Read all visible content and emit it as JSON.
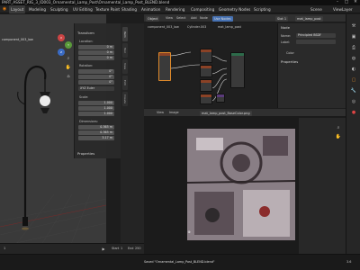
{
  "window": {
    "title": "PART_ASSET_RIG_3_ID003_Ornamental_Lamp_Post\\Ornamental_Lamp_Post_BLEND.blend",
    "minimize_icon": "minimize-icon",
    "maximize_icon": "maximize-icon",
    "close_icon": "close-icon"
  },
  "menubar": {
    "items": [
      "Layout",
      "Modeling",
      "Sculpting",
      "UV Editing",
      "Texture Paint",
      "Shading",
      "Animation",
      "Rendering",
      "Compositing",
      "Geometry Nodes",
      "Scripting"
    ],
    "active_index": 0,
    "scene_label": "Scene",
    "view_layer_label": "ViewLayer"
  },
  "viewport": {
    "collection_label": "component_003_low",
    "n_panel": {
      "transform_header": "Transform",
      "location_label": "Location:",
      "location_values": [
        "0 m",
        "0 m",
        "0 m"
      ],
      "rotation_label": "Rotation:",
      "rotation_values": [
        "0°",
        "0°",
        "0°"
      ],
      "rotation_mode": "XYZ Euler",
      "scale_label": "Scale:",
      "scale_values": [
        "1.000",
        "1.000",
        "1.000"
      ],
      "dimensions_label": "Dimensions:",
      "dimension_values": [
        "0.365 m",
        "0.365 m",
        "3.17 m"
      ],
      "properties_header": "Properties"
    },
    "tabs": [
      "Item",
      "Tool",
      "View",
      "Edit",
      "Create"
    ]
  },
  "node_editor": {
    "header_buttons": [
      "Object",
      "View",
      "Select",
      "Add",
      "Node"
    ],
    "use_nodes_label": "Use Nodes",
    "slot_label": "Slot 1",
    "material_label": "mat_lamp_post",
    "breadcrumbs": [
      "component_003_low",
      "Cylinder.003",
      "mat_lamp_post"
    ],
    "side": {
      "node_header": "Node",
      "name_label": "Name:",
      "name_value": "Principled BSDF",
      "label_label": "Label:",
      "color_label": "Color",
      "properties_header": "Properties"
    }
  },
  "image_editor": {
    "header_buttons": [
      "View",
      "Image"
    ],
    "image_name": "mat_lamp_post_BaseColor.png"
  },
  "timeline": {
    "frame_start_label": "Start",
    "frame_start": "1",
    "frame_end_label": "End",
    "frame_end": "250",
    "current_frame": "1"
  },
  "statusbar": {
    "message": "Saved \"Ornamental_Lamp_Post_BLEND.blend\"",
    "version": "3.6"
  },
  "colors": {
    "accent_blue": "#4772b3",
    "active_orange": "#e08a2a",
    "node_header_texture": "#8b4226",
    "node_header_shader": "#2d6b4a"
  }
}
